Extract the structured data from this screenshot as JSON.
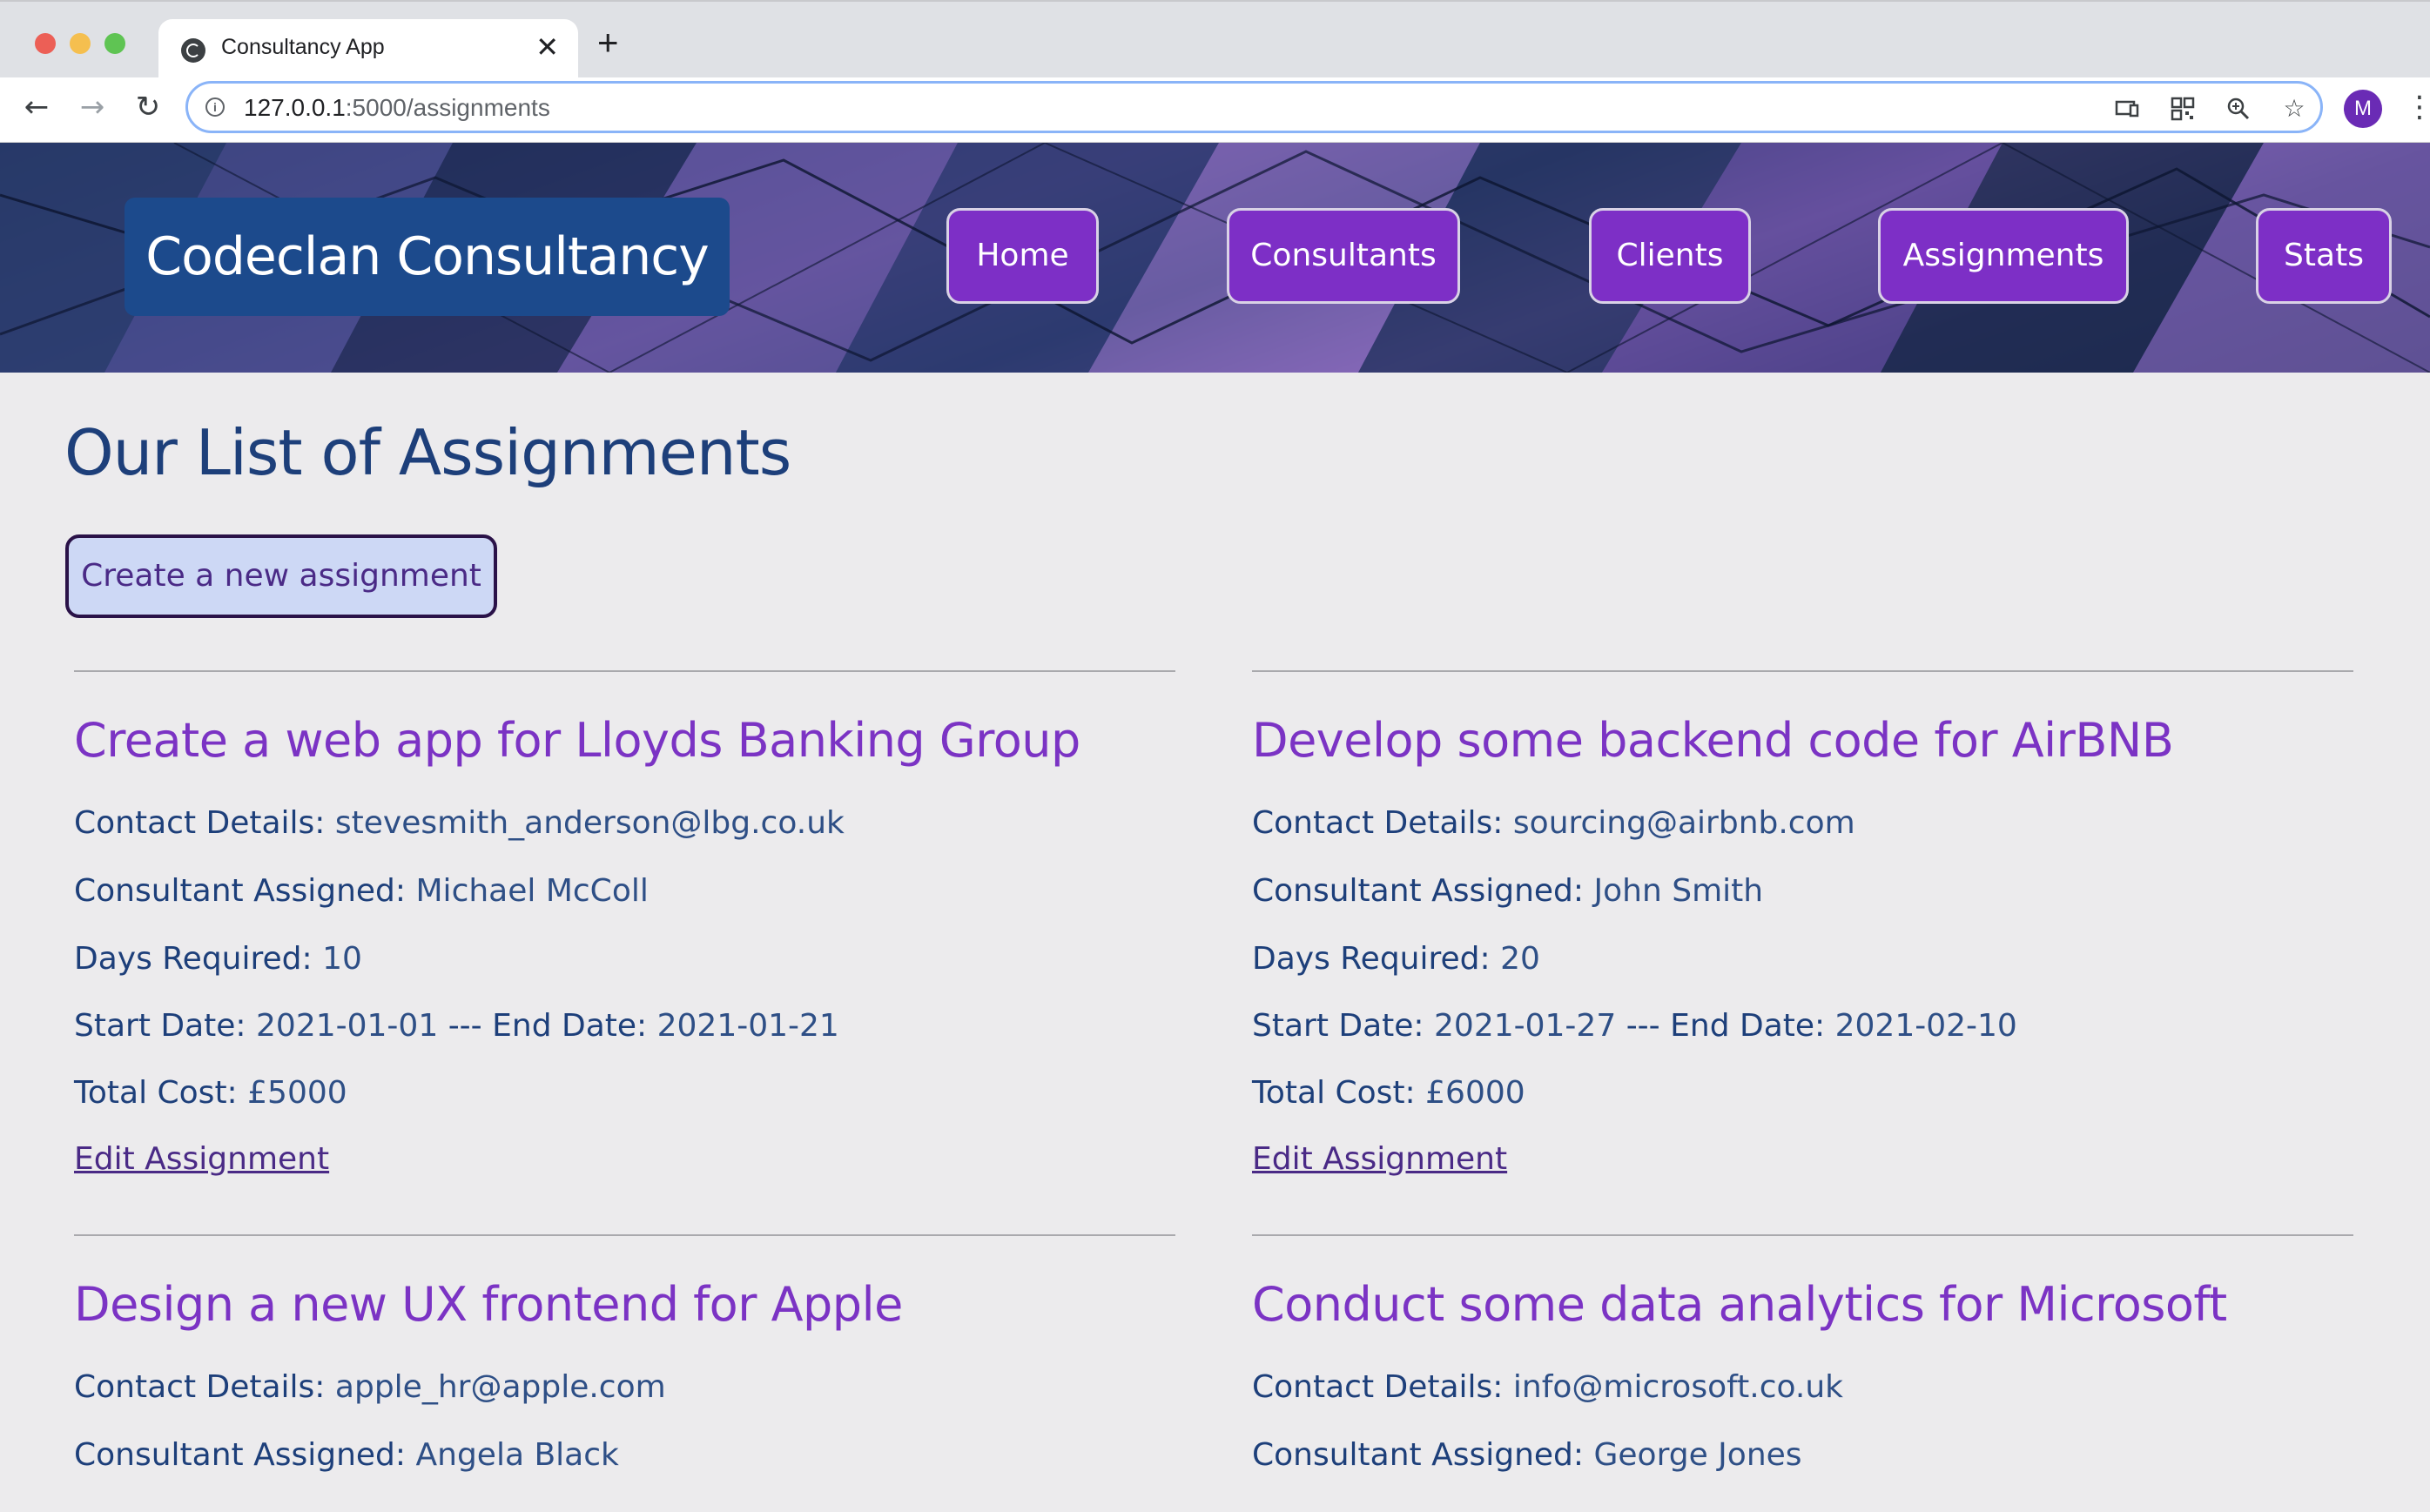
{
  "browser": {
    "tab_title": "Consultancy App",
    "url_host": "127.0.0.1",
    "url_path": ":5000/assignments",
    "profile_initial": "M"
  },
  "site": {
    "brand": "Codeclan Consultancy",
    "nav": [
      "Home",
      "Consultants",
      "Clients",
      "Assignments",
      "Stats"
    ]
  },
  "page": {
    "title": "Our List of Assignments",
    "create_label": "Create a new assignment"
  },
  "labels": {
    "contact": "Contact Details:",
    "consultant": "Consultant Assigned:",
    "days": "Days Required:",
    "start": "Start Date:",
    "separator": "---",
    "end": "End Date:",
    "cost": "Total Cost:",
    "edit": "Edit Assignment"
  },
  "assignments": [
    {
      "title": "Create a web app for Lloyds Banking Group",
      "contact": "stevesmith_anderson@lbg.co.uk",
      "consultant": "Michael McColl",
      "days": "10",
      "start": "2021-01-01",
      "end": "2021-01-21",
      "cost": "£5000"
    },
    {
      "title": "Develop some backend code for AirBNB",
      "contact": "sourcing@airbnb.com",
      "consultant": "John Smith",
      "days": "20",
      "start": "2021-01-27",
      "end": "2021-02-10",
      "cost": "£6000"
    },
    {
      "title": "Design a new UX frontend for Apple",
      "contact": "apple_hr@apple.com",
      "consultant": "Angela Black"
    },
    {
      "title": "Conduct some data analytics for Microsoft",
      "contact": "info@microsoft.co.uk",
      "consultant": "George Jones"
    }
  ]
}
